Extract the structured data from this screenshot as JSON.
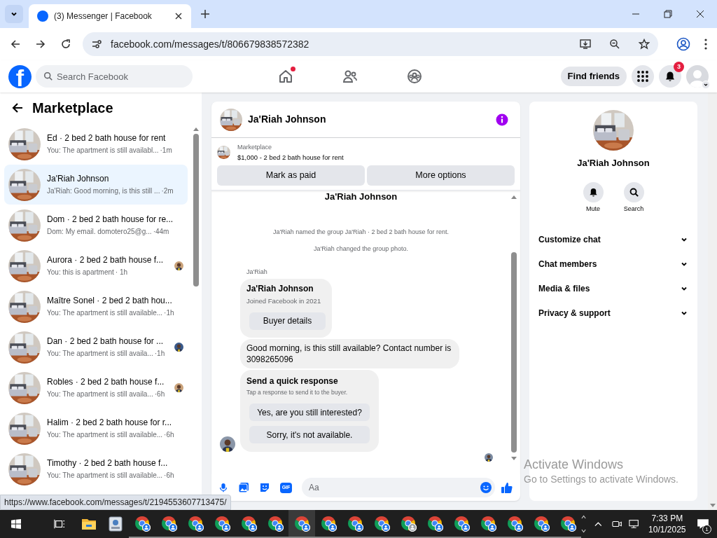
{
  "browser": {
    "tabs": [
      {
        "title": "(3) Messenger | Facebook",
        "selected": true
      }
    ],
    "url": "facebook.com/messages/t/806679838572382"
  },
  "header": {
    "logo_letter": "f",
    "search": {
      "placeholder": "Search Facebook"
    },
    "nav": [
      {
        "kind": "home",
        "alert": true
      },
      {
        "kind": "friends",
        "alert": false
      },
      {
        "kind": "groups",
        "alert": false
      }
    ],
    "find_friends": "Find friends",
    "notifications_badge": "3"
  },
  "sidebar": {
    "title": "Marketplace",
    "conversations": [
      {
        "title": "Ed · 2 bed 2 bath house for rent",
        "preview": "You: The apartment is still availabl...",
        "time": "·1m",
        "selected": false,
        "seen": false
      },
      {
        "title": "Ja'Riah Johnson",
        "preview": "Ja'Riah: Good morning, is this still ...",
        "time": "·2m",
        "selected": true,
        "seen": false
      },
      {
        "title": "Dom · 2 bed 2 bath house for re...",
        "preview": "Dom: My email. domotero25@g...",
        "time": "·44m",
        "selected": false,
        "seen": false
      },
      {
        "title": "Aurora · 2 bed 2 bath house f...",
        "preview": "You: this is apartment",
        "time": "· 1h",
        "selected": false,
        "seen": true
      },
      {
        "title": "Maître Sonel · 2 bed 2 bath hou...",
        "preview": "You: The apartment is still available...",
        "time": "·1h",
        "selected": false,
        "seen": false
      },
      {
        "title": "Dan · 2 bed 2 bath house for ...",
        "preview": "You: The apartment is still availa...",
        "time": "·1h",
        "selected": false,
        "seen": true
      },
      {
        "title": "Robles · 2 bed 2 bath house f...",
        "preview": "You: The apartment is still availa...",
        "time": "·6h",
        "selected": false,
        "seen": true
      },
      {
        "title": "Halim · 2 bed 2 bath house for r...",
        "preview": "You: The apartment is still available...",
        "time": "·6h",
        "selected": false,
        "seen": false
      },
      {
        "title": "Timothy · 2 bed 2 bath house f...",
        "preview": "You: The apartment is still available...",
        "time": "·6h",
        "selected": false,
        "seen": false
      }
    ]
  },
  "chat": {
    "name": "Ja'Riah Johnson",
    "listing": {
      "label": "Marketplace",
      "title": "$1,000 - 2 bed 2 bath house for rent"
    },
    "actions": [
      "Mark as paid",
      "More options"
    ],
    "cut_heading": "Ja'Riah Johnson",
    "events": [
      "Ja'Riah named the group Ja'Riah · 2 bed 2 bath house for rent.",
      "Ja'Riah changed the group photo."
    ],
    "sender": "Ja'Riah",
    "profile_card": {
      "name": "Ja'Riah Johnson",
      "joined": "Joined Facebook in 2021",
      "button": "Buyer details"
    },
    "message": "Good morning, is this still available? Contact number is 3098265096",
    "quick_response": {
      "title": "Send a quick response",
      "subtitle": "Tap a response to send it to the buyer.",
      "options": [
        "Yes, are you still interested?",
        "Sorry, it's not available."
      ]
    },
    "composer": {
      "gif_label": "GIF",
      "placeholder": "Aa"
    }
  },
  "info": {
    "name": "Ja'Riah Johnson",
    "actions": [
      {
        "kind": "bell",
        "label": "Mute"
      },
      {
        "kind": "search",
        "label": "Search"
      }
    ],
    "sections": [
      "Customize chat",
      "Chat members",
      "Media & files",
      "Privacy & support"
    ]
  },
  "status_url": "https://www.facebook.com/messages/t/2194553607713475/",
  "activation": {
    "title": "Activate Windows",
    "subtitle": "Go to Settings to activate Windows."
  },
  "taskbar": {
    "apps": [
      {
        "kind": "explorer",
        "selected": false
      },
      {
        "kind": "app",
        "selected": false
      },
      {
        "kind": "chrome",
        "selected": false
      },
      {
        "kind": "chrome",
        "selected": false
      },
      {
        "kind": "chrome",
        "selected": false
      },
      {
        "kind": "chrome",
        "selected": false
      },
      {
        "kind": "chrome",
        "selected": false
      },
      {
        "kind": "chrome",
        "selected": false
      },
      {
        "kind": "chrome",
        "selected": true
      },
      {
        "kind": "chrome",
        "selected": false
      },
      {
        "kind": "chrome",
        "selected": false
      },
      {
        "kind": "chrome",
        "selected": false
      },
      {
        "kind": "chrome_grey",
        "selected": false
      },
      {
        "kind": "chrome",
        "selected": false
      },
      {
        "kind": "chrome",
        "selected": false
      },
      {
        "kind": "chrome",
        "selected": false
      },
      {
        "kind": "chrome",
        "selected": false
      },
      {
        "kind": "chrome",
        "selected": false
      },
      {
        "kind": "chrome",
        "selected": false
      }
    ],
    "time": "7:33 PM",
    "date": "10/1/2025",
    "notifications": "1"
  }
}
